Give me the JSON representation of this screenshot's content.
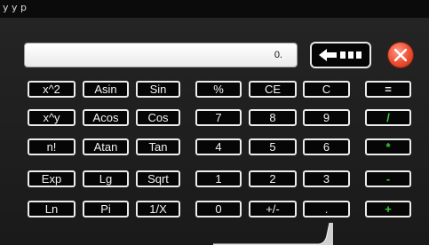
{
  "topbar": {
    "glyph": "y y p"
  },
  "display": {
    "value": "0."
  },
  "icons": {
    "backspace": "backspace-arrow-icon",
    "close": "close-x-icon"
  },
  "colors": {
    "close_button": "#ec4c2f",
    "operator_key_text": "#3ccc3c"
  },
  "keys": {
    "row1": [
      "x^2",
      "Asin",
      "Sin",
      "%",
      "CE",
      "C",
      "="
    ],
    "row2": [
      "x^y",
      "Acos",
      "Cos",
      "7",
      "8",
      "9",
      "/"
    ],
    "row3": [
      "n!",
      "Atan",
      "Tan",
      "4",
      "5",
      "6",
      "*"
    ],
    "row4": [
      "Exp",
      "Lg",
      "Sqrt",
      "1",
      "2",
      "3",
      "-"
    ],
    "row5": [
      "Ln",
      "Pi",
      "1/X",
      "0",
      "+/-",
      ".",
      "+"
    ]
  }
}
